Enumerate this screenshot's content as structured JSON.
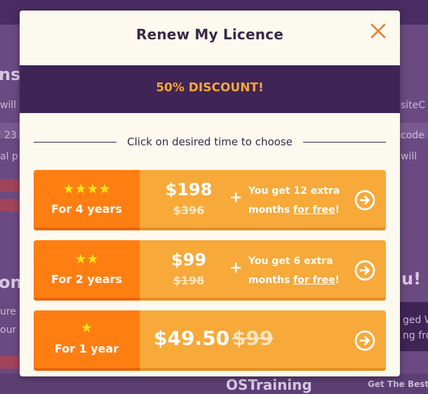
{
  "modal": {
    "title": "Renew My Licence",
    "close_icon": "close-icon",
    "discount": "50% DISCOUNT!",
    "instruction": "Click on desired time to choose"
  },
  "options": [
    {
      "stars": "★★★★",
      "rating": 4,
      "duration": "For 4 years",
      "price_new": "$198",
      "price_old": "$396",
      "plus": "+",
      "bonus_line1": "You get 12 extra",
      "bonus_line2_prefix": "months ",
      "bonus_link": "for free",
      "bonus_suffix": "!",
      "icon": "arrow-right-circle-icon"
    },
    {
      "stars": "★★",
      "rating": 2,
      "duration": "For 2 years",
      "price_new": "$99",
      "price_old": "$198",
      "plus": "+",
      "bonus_line1": "You get 6 extra",
      "bonus_line2_prefix": "months ",
      "bonus_link": "for free",
      "bonus_suffix": "!",
      "icon": "arrow-right-circle-icon"
    },
    {
      "stars": "★",
      "rating": 1,
      "duration": "For 1 year",
      "price_new": "$49.50",
      "price_old": "$99",
      "icon": "arrow-right-circle-icon"
    }
  ],
  "background": {
    "text_fragments": [
      "nse",
      "will",
      "23",
      "al p",
      "ona",
      "ure",
      "our",
      "siteC",
      "code",
      "will",
      "u!",
      "ged W",
      "ng fro",
      "OSTraining",
      "Get The Best"
    ]
  },
  "colors": {
    "accent_orange": "#ff7e12",
    "light_orange": "#f7a93a",
    "purple": "#3f2456",
    "discount_text": "#f7a836",
    "star_yellow": "#ffe21a",
    "modal_bg": "#fcf9ef"
  }
}
